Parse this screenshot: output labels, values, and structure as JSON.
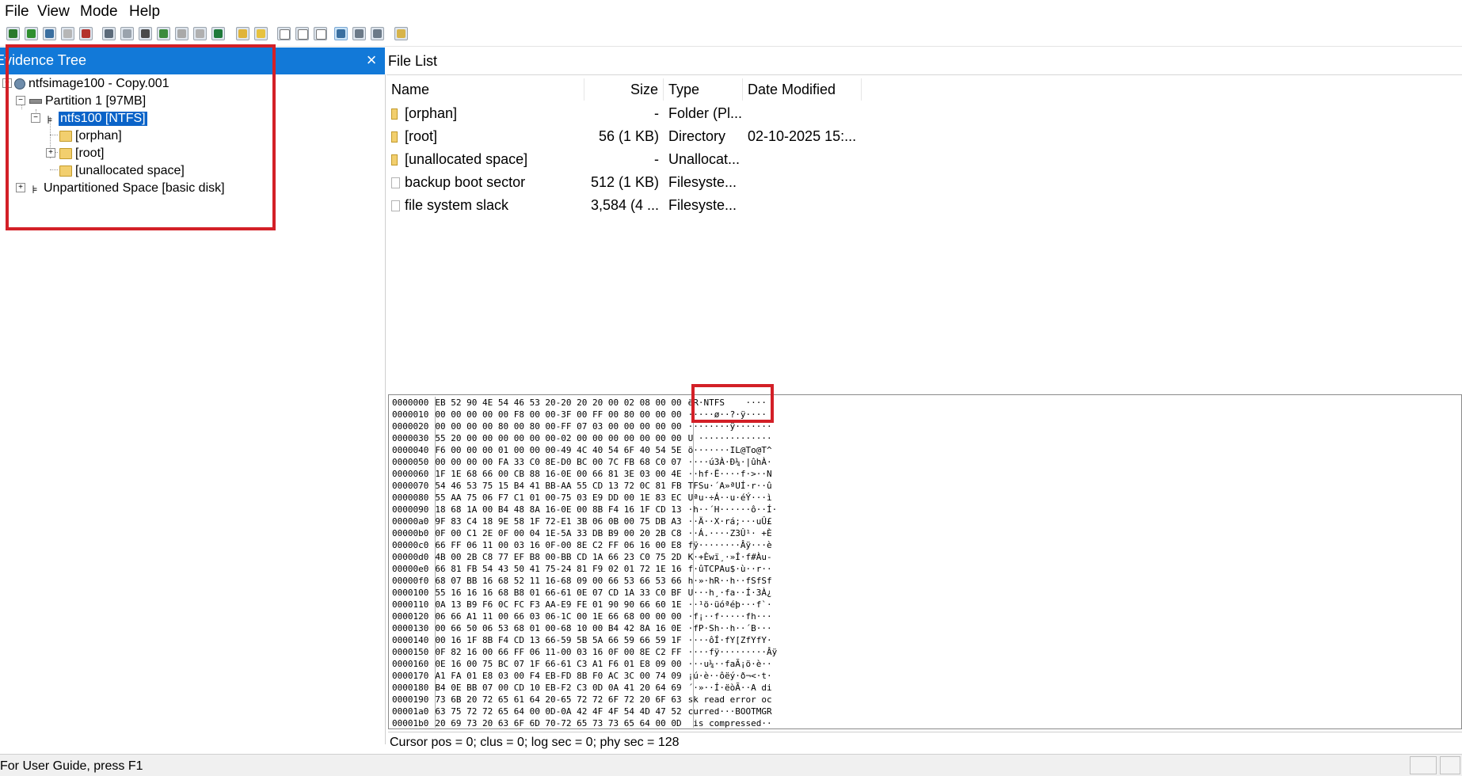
{
  "menu": [
    "File",
    "View",
    "Mode",
    "Help"
  ],
  "toolbar": {
    "icons": [
      "add-evidence-icon",
      "add-image-icon",
      "add-folder-icon",
      "remove-evidence-icon",
      "remove-all-icon",
      "create-disk-image-icon",
      "export-files-icon",
      "export-hash-icon",
      "verify-drive-icon",
      "obtain-protected-icon",
      "capture-memory-icon",
      "detect-encryption-icon",
      "image-mounting-icon",
      "custom-content-icon",
      "decrypt-icon",
      "file-list-icon",
      "properties-icon",
      "report-icon",
      "view-mode-auto-icon",
      "view-mode-text-icon",
      "view-mode-hex-icon",
      "help-icon"
    ],
    "more_label": "▾"
  },
  "evidence_tree": {
    "title": "Evidence Tree",
    "close_icon": "×",
    "items": [
      {
        "label": "ntfsimage100 - Copy.001",
        "level": 0
      },
      {
        "label": "Partition 1 [97MB]",
        "level": 1
      },
      {
        "label": "ntfs100 [NTFS]",
        "level": 2,
        "selected": true
      },
      {
        "label": "[orphan]",
        "level": 3
      },
      {
        "label": "[root]",
        "level": 3
      },
      {
        "label": "[unallocated space]",
        "level": 3
      },
      {
        "label": "Unpartitioned Space [basic disk]",
        "level": 1
      }
    ]
  },
  "file_list": {
    "title": "File List",
    "columns": [
      "Name",
      "Size",
      "Type",
      "Date Modified"
    ],
    "rows": [
      {
        "name": "[orphan]",
        "size": "-",
        "type": "Folder (Pl...",
        "date": "",
        "icon": "folder-icon"
      },
      {
        "name": "[root]",
        "size": "56 (1 KB)",
        "type": "Directory",
        "date": "02-10-2025 15:...",
        "icon": "folder-icon"
      },
      {
        "name": "[unallocated space]",
        "size": "-",
        "type": "Unallocat...",
        "date": "",
        "icon": "folder-icon"
      },
      {
        "name": "backup boot sector",
        "size": "512 (1 KB)",
        "type": "Filesyste...",
        "date": "",
        "icon": "file-icon"
      },
      {
        "name": "file system slack",
        "size": "3,584 (4 ...",
        "type": "Filesyste...",
        "date": "",
        "icon": "file-icon"
      }
    ]
  },
  "hex_view": {
    "lines": [
      {
        "offset": "0000000",
        "hex": "EB 52 90 4E 54 46 53 20-20 20 20 00 02 08 00 00",
        "ascii": "ëR·NTFS    ····"
      },
      {
        "offset": "0000010",
        "hex": "00 00 00 00 00 F8 00 00-3F 00 FF 00 80 00 00 00",
        "ascii": "·····ø··?·ÿ····"
      },
      {
        "offset": "0000020",
        "hex": "00 00 00 00 80 00 80 00-FF 07 03 00 00 00 00 00",
        "ascii": "········ÿ·······"
      },
      {
        "offset": "0000030",
        "hex": "55 20 00 00 00 00 00 00-02 00 00 00 00 00 00 00",
        "ascii": "U ··············"
      },
      {
        "offset": "0000040",
        "hex": "F6 00 00 00 01 00 00 00-49 4C 40 54 6F 40 54 5E",
        "ascii": "ö·······IL@To@T^"
      },
      {
        "offset": "0000050",
        "hex": "00 00 00 00 FA 33 C0 8E-D0 BC 00 7C FB 68 C0 07",
        "ascii": "····ú3À·Ð¼·|ûhÀ·"
      },
      {
        "offset": "0000060",
        "hex": "1F 1E 68 66 00 CB 88 16-0E 00 66 81 3E 03 00 4E",
        "ascii": "··hf·Ë····f·>··N"
      },
      {
        "offset": "0000070",
        "hex": "54 46 53 75 15 B4 41 BB-AA 55 CD 13 72 0C 81 FB",
        "ascii": "TFSu·´A»ªUÍ·r··û"
      },
      {
        "offset": "0000080",
        "hex": "55 AA 75 06 F7 C1 01 00-75 03 E9 DD 00 1E 83 EC",
        "ascii": "Uªu·÷Á··u·éÝ···ì"
      },
      {
        "offset": "0000090",
        "hex": "18 68 1A 00 B4 48 8A 16-0E 00 8B F4 16 1F CD 13",
        "ascii": "·h··´H······ô··Í·"
      },
      {
        "offset": "00000a0",
        "hex": "9F 83 C4 18 9E 58 1F 72-E1 3B 06 0B 00 75 DB A3",
        "ascii": "··Ä··X·rá;···uÛ£"
      },
      {
        "offset": "00000b0",
        "hex": "0F 00 C1 2E 0F 00 04 1E-5A 33 DB B9 00 20 2B C8",
        "ascii": "··Á.····Z3Û¹· +È"
      },
      {
        "offset": "00000c0",
        "hex": "66 FF 06 11 00 03 16 0F-00 8E C2 FF 06 16 00 E8",
        "ascii": "fÿ········Âÿ···è"
      },
      {
        "offset": "00000d0",
        "hex": "4B 00 2B C8 77 EF B8 00-BB CD 1A 66 23 C0 75 2D",
        "ascii": "K·+Èwï¸·»Í·f#Àu-"
      },
      {
        "offset": "00000e0",
        "hex": "66 81 FB 54 43 50 41 75-24 81 F9 02 01 72 1E 16",
        "ascii": "f·ûTCPAu$·ù··r··"
      },
      {
        "offset": "00000f0",
        "hex": "68 07 BB 16 68 52 11 16-68 09 00 66 53 66 53 66",
        "ascii": "h·»·hR··h··fSfSf"
      },
      {
        "offset": "0000100",
        "hex": "55 16 16 16 68 B8 01 66-61 0E 07 CD 1A 33 C0 BF",
        "ascii": "U···h¸·fa··Í·3À¿"
      },
      {
        "offset": "0000110",
        "hex": "0A 13 B9 F6 0C FC F3 AA-E9 FE 01 90 90 66 60 1E",
        "ascii": "··¹ö·üóªéþ···f`·"
      },
      {
        "offset": "0000120",
        "hex": "06 66 A1 11 00 66 03 06-1C 00 1E 66 68 00 00 00",
        "ascii": "·f¡··f·····fh···"
      },
      {
        "offset": "0000130",
        "hex": "00 66 50 06 53 68 01 00-68 10 00 B4 42 8A 16 0E",
        "ascii": "·fP·Sh··h··´B···"
      },
      {
        "offset": "0000140",
        "hex": "00 16 1F 8B F4 CD 13 66-59 5B 5A 66 59 66 59 1F",
        "ascii": "····ôÍ·fY[ZfYfY·"
      },
      {
        "offset": "0000150",
        "hex": "0F 82 16 00 66 FF 06 11-00 03 16 0F 00 8E C2 FF",
        "ascii": "····fÿ·········Âÿ"
      },
      {
        "offset": "0000160",
        "hex": "0E 16 00 75 BC 07 1F 66-61 C3 A1 F6 01 E8 09 00",
        "ascii": "···u¼··faÃ¡ö·è··"
      },
      {
        "offset": "0000170",
        "hex": "A1 FA 01 E8 03 00 F4 EB-FD 8B F0 AC 3C 00 74 09",
        "ascii": "¡ú·è··ôëý·ð¬<·t·"
      },
      {
        "offset": "0000180",
        "hex": "B4 0E BB 07 00 CD 10 EB-F2 C3 0D 0A 41 20 64 69",
        "ascii": "´·»··Í·ëòÃ··A di"
      },
      {
        "offset": "0000190",
        "hex": "73 6B 20 72 65 61 64 20-65 72 72 6F 72 20 6F 63",
        "ascii": "sk read error oc"
      },
      {
        "offset": "00001a0",
        "hex": "63 75 72 72 65 64 00 0D-0A 42 4F 4F 54 4D 47 52",
        "ascii": "curred···BOOTMGR"
      },
      {
        "offset": "00001b0",
        "hex": "20 69 73 20 63 6F 6D 70-72 65 73 73 65 64 00 0D",
        "ascii": " is compressed··"
      }
    ]
  },
  "cursor_status": "Cursor pos = 0; clus = 0; log sec = 0; phy sec = 128",
  "status_bar": "For User Guide, press F1",
  "colors": {
    "accent": "#1279d8",
    "selected": "#0a63c8",
    "highlight": "#d32027"
  }
}
